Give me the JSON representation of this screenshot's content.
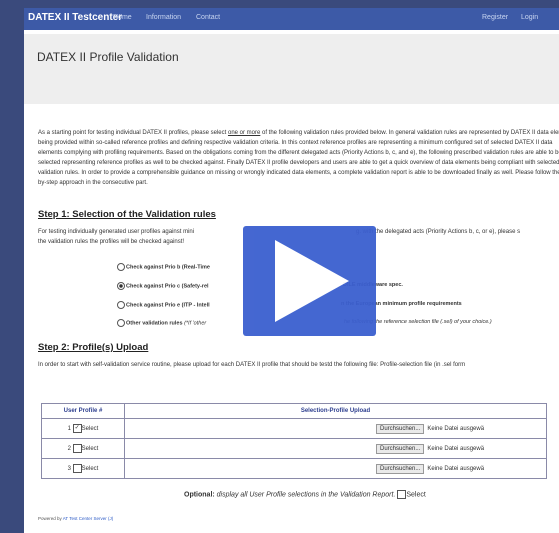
{
  "nav": {
    "brand": "DATEX II Testcenter",
    "links": [
      "Home",
      "Information",
      "Contact"
    ],
    "right_links": [
      "Register",
      "Login"
    ]
  },
  "hero": {
    "title": "DATEX II Profile Validation"
  },
  "intro": {
    "part1": "As a starting point for testing individual DATEX II profiles, please select ",
    "link": "one or more",
    "part2": " of the following validation rules provided below. In general validation rules are represented by DATEX II data elements being provided within so-called reference profiles and defining respective validation criteria. In this context reference profiles are representing a minimum configured set of selected DATEX II data elements complying with profiling requirements. Based on the obligations coming from the different delegated acts (Priority Actions b, c, and e), the following prescribed validation rules are able to be selected representing reference profiles as well to be checked against. Finally DATEX II profile developers and users are able to get a quick overview of data elements being compliant with selected validation rules. In order to provide a comprehensible guidance on missing or wrongly indicated data elements, a complete validation report is able to be downloaded finally as well. Please follow the step-by-step approach in the consecutive part."
  },
  "step1": {
    "heading": "Step 1: Selection of the Validation rules",
    "text": "For testing individually generated user profiles against mini",
    "text_right": "g. with the delegated acts (Priority Actions b, c, or e), please s",
    "text2": "the validation rules the profiles will be checked against!",
    "options": [
      {
        "label": "Check against Prio b (Real-Time",
        "right": "",
        "selected": false
      },
      {
        "label": "Check against Prio c (Safety-rel",
        "right": "DILE middleware spec.",
        "selected": true
      },
      {
        "label": "Check against Prio e (ITP - Intell",
        "right": "n the European minimum profile requirements",
        "selected": false
      },
      {
        "label": "Other validation rules",
        "note": "(*If 'other",
        "right": "he following the reference selection file (.sel) of your choice.)",
        "selected": false
      }
    ]
  },
  "step2": {
    "heading": "Step 2: Profile(s) Upload",
    "text": "In order to start with self-validation service routine, please upload for each DATEX II profile that should be testd the following file: Profile-selection file (in .sel form"
  },
  "table": {
    "headers": [
      "User Profile #",
      "Selection-Profile Upload"
    ],
    "rows": [
      {
        "num": "1",
        "select": "Select",
        "checked": true,
        "button": "Durchsuchen...",
        "file": "Keine Datei ausgewä"
      },
      {
        "num": "2",
        "select": "Select",
        "checked": false,
        "button": "Durchsuchen...",
        "file": "Keine Datei ausgewä"
      },
      {
        "num": "3",
        "select": "Select",
        "checked": false,
        "button": "Durchsuchen...",
        "file": "Keine Datei ausgewä"
      }
    ]
  },
  "optional": {
    "bold": "Optional:",
    "text": " display all User Profile selections in the Validation Report.",
    "select": "Select"
  },
  "footer": {
    "text": "Powered by ",
    "link": "AT Test Center Server (J)"
  },
  "colors": {
    "navbar": "#3d5aa7",
    "backdrop": "#3a4a7c",
    "play_overlay": "#3b5fcf"
  },
  "overlay_icon": "play-icon"
}
